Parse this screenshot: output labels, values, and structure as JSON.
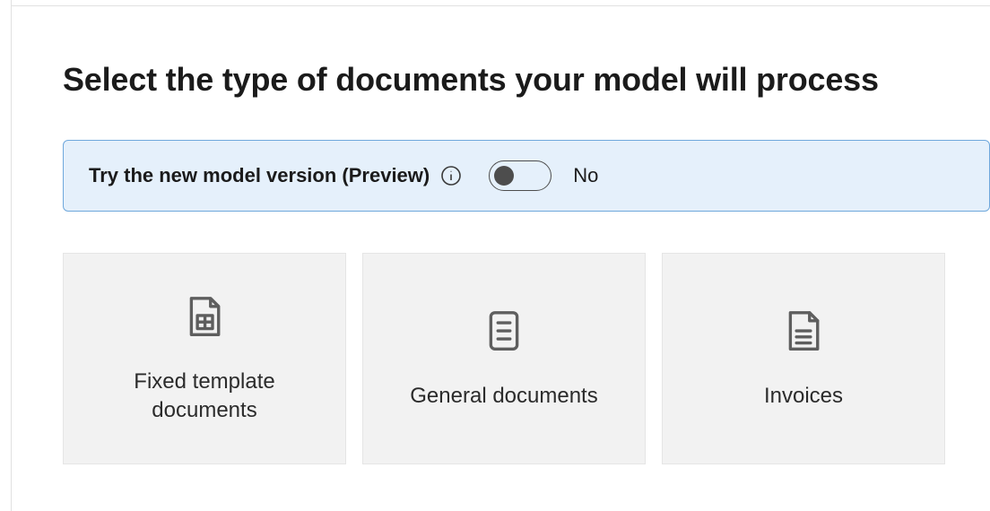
{
  "page": {
    "title": "Select the type of documents your model will process"
  },
  "banner": {
    "label": "Try the new model version (Preview)",
    "toggle_state_label": "No"
  },
  "cards": [
    {
      "label": "Fixed template documents"
    },
    {
      "label": "General documents"
    },
    {
      "label": "Invoices"
    }
  ]
}
